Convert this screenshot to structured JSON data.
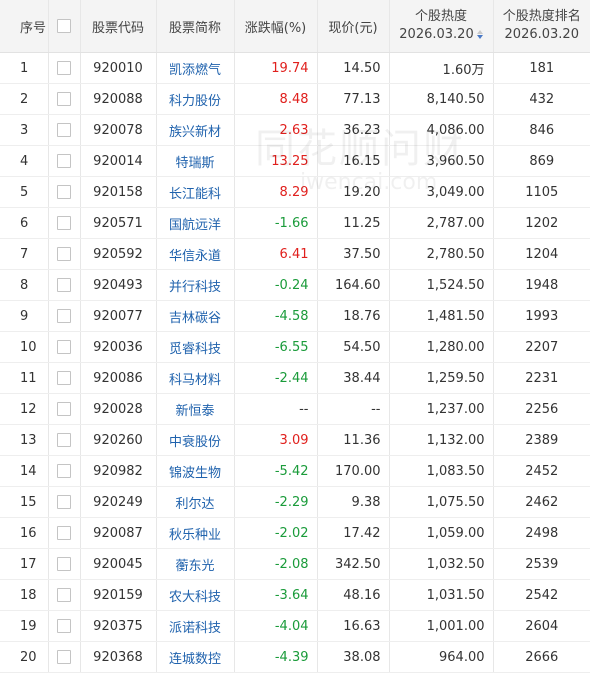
{
  "headers": {
    "index": "序号",
    "code": "股票代码",
    "name": "股票简称",
    "change": "涨跌幅(%)",
    "price": "现价(元)",
    "heat_line1": "个股热度",
    "heat_line2": "2026.03.20",
    "rank_line1": "个股热度排名",
    "rank_line2": "2026.03.20"
  },
  "watermark": {
    "text": "同花顺问财",
    "subtext": "iwencai.com"
  },
  "colors": {
    "up": "#e0201d",
    "down": "#1a9b3a",
    "link": "#1f62ad",
    "sort_active": "#4a79c6"
  },
  "rows": [
    {
      "index": "1",
      "code": "920010",
      "name": "凯添燃气",
      "change": "19.74",
      "dir": "up",
      "price": "14.50",
      "heat": "1.60万",
      "rank": "181"
    },
    {
      "index": "2",
      "code": "920088",
      "name": "科力股份",
      "change": "8.48",
      "dir": "up",
      "price": "77.13",
      "heat": "8,140.50",
      "rank": "432"
    },
    {
      "index": "3",
      "code": "920078",
      "name": "族兴新材",
      "change": "2.63",
      "dir": "up",
      "price": "36.23",
      "heat": "4,086.00",
      "rank": "846"
    },
    {
      "index": "4",
      "code": "920014",
      "name": "特瑞斯",
      "change": "13.25",
      "dir": "up",
      "price": "16.15",
      "heat": "3,960.50",
      "rank": "869"
    },
    {
      "index": "5",
      "code": "920158",
      "name": "长江能科",
      "change": "8.29",
      "dir": "up",
      "price": "19.20",
      "heat": "3,049.00",
      "rank": "1105"
    },
    {
      "index": "6",
      "code": "920571",
      "name": "国航远洋",
      "change": "-1.66",
      "dir": "down",
      "price": "11.25",
      "heat": "2,787.00",
      "rank": "1202"
    },
    {
      "index": "7",
      "code": "920592",
      "name": "华信永道",
      "change": "6.41",
      "dir": "up",
      "price": "37.50",
      "heat": "2,780.50",
      "rank": "1204"
    },
    {
      "index": "8",
      "code": "920493",
      "name": "并行科技",
      "change": "-0.24",
      "dir": "down",
      "price": "164.60",
      "heat": "1,524.50",
      "rank": "1948"
    },
    {
      "index": "9",
      "code": "920077",
      "name": "吉林碳谷",
      "change": "-4.58",
      "dir": "down",
      "price": "18.76",
      "heat": "1,481.50",
      "rank": "1993"
    },
    {
      "index": "10",
      "code": "920036",
      "name": "觅睿科技",
      "change": "-6.55",
      "dir": "down",
      "price": "54.50",
      "heat": "1,280.00",
      "rank": "2207"
    },
    {
      "index": "11",
      "code": "920086",
      "name": "科马材料",
      "change": "-2.44",
      "dir": "down",
      "price": "38.44",
      "heat": "1,259.50",
      "rank": "2231"
    },
    {
      "index": "12",
      "code": "920028",
      "name": "新恒泰",
      "change": "--",
      "dir": "none",
      "price": "--",
      "heat": "1,237.00",
      "rank": "2256"
    },
    {
      "index": "13",
      "code": "920260",
      "name": "中衰股份",
      "change": "3.09",
      "dir": "up",
      "price": "11.36",
      "heat": "1,132.00",
      "rank": "2389"
    },
    {
      "index": "14",
      "code": "920982",
      "name": "锦波生物",
      "change": "-5.42",
      "dir": "down",
      "price": "170.00",
      "heat": "1,083.50",
      "rank": "2452"
    },
    {
      "index": "15",
      "code": "920249",
      "name": "利尔达",
      "change": "-2.29",
      "dir": "down",
      "price": "9.38",
      "heat": "1,075.50",
      "rank": "2462"
    },
    {
      "index": "16",
      "code": "920087",
      "name": "秋乐种业",
      "change": "-2.02",
      "dir": "down",
      "price": "17.42",
      "heat": "1,059.00",
      "rank": "2498"
    },
    {
      "index": "17",
      "code": "920045",
      "name": "蘅东光",
      "change": "-2.08",
      "dir": "down",
      "price": "342.50",
      "heat": "1,032.50",
      "rank": "2539"
    },
    {
      "index": "18",
      "code": "920159",
      "name": "农大科技",
      "change": "-3.64",
      "dir": "down",
      "price": "48.16",
      "heat": "1,031.50",
      "rank": "2542"
    },
    {
      "index": "19",
      "code": "920375",
      "name": "派诺科技",
      "change": "-4.04",
      "dir": "down",
      "price": "16.63",
      "heat": "1,001.00",
      "rank": "2604"
    },
    {
      "index": "20",
      "code": "920368",
      "name": "连城数控",
      "change": "-4.39",
      "dir": "down",
      "price": "38.08",
      "heat": "964.00",
      "rank": "2666"
    }
  ]
}
